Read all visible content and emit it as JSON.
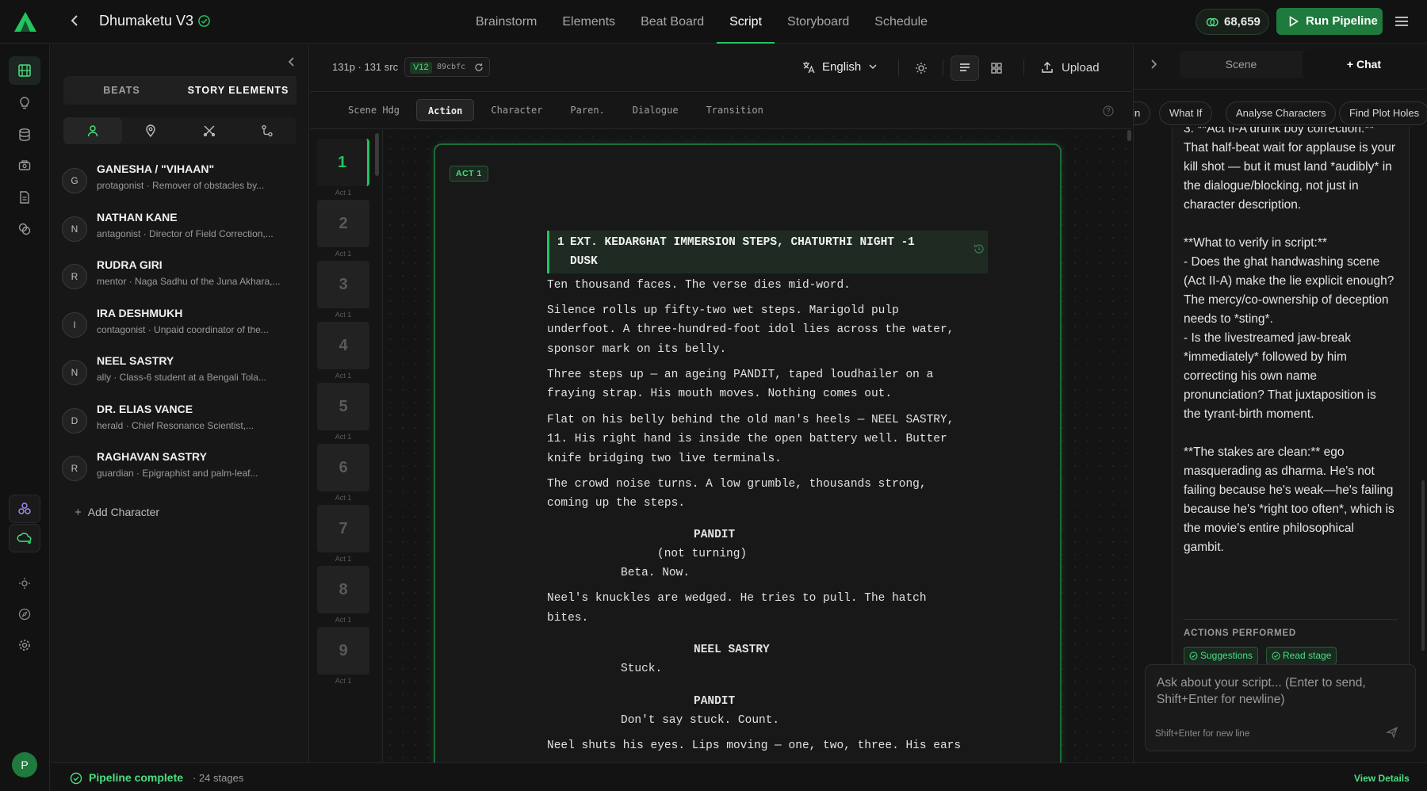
{
  "header": {
    "project_title": "Dhumaketu V3",
    "nav_tabs": [
      "Brainstorm",
      "Elements",
      "Beat Board",
      "Script",
      "Storyboard",
      "Schedule"
    ],
    "active_tab": "Script",
    "credits": "68,659",
    "run_label": "Run Pipeline",
    "accent_color": "#22c55e"
  },
  "left_panel": {
    "tabs": [
      "BEATS",
      "STORY ELEMENTS"
    ],
    "active_tab": "STORY ELEMENTS",
    "filters": [
      "person-icon",
      "location-pin-icon",
      "prop-icon",
      "flow-icon"
    ],
    "characters": [
      {
        "initial": "G",
        "name": "GANESHA / \"VIHAAN\"",
        "desc": "protagonist · Remover of obstacles by..."
      },
      {
        "initial": "N",
        "name": "NATHAN KANE",
        "desc": "antagonist · Director of Field Correction,..."
      },
      {
        "initial": "R",
        "name": "RUDRA GIRI",
        "desc": "mentor · Naga Sadhu of the Juna Akhara,..."
      },
      {
        "initial": "I",
        "name": "IRA DESHMUKH",
        "desc": "contagonist · Unpaid coordinator of the..."
      },
      {
        "initial": "N",
        "name": "NEEL SASTRY",
        "desc": "ally · Class-6 student at a Bengali Tola..."
      },
      {
        "initial": "D",
        "name": "DR. ELIAS VANCE",
        "desc": "herald · Chief Resonance Scientist,..."
      },
      {
        "initial": "R",
        "name": "RAGHAVAN SASTRY",
        "desc": "guardian · Epigraphist and palm-leaf..."
      }
    ],
    "add_label": "Add Character"
  },
  "toolbar": {
    "page_count": "131p · 131 src",
    "version": "V12",
    "hash": "89cbfc",
    "language": "English",
    "upload_label": "Upload",
    "elements": [
      "Scene Hdg",
      "Action",
      "Character",
      "Paren.",
      "Dialogue",
      "Transition"
    ],
    "active_element": "Action"
  },
  "scenes": [
    {
      "num": "1",
      "act": "Act 1"
    },
    {
      "num": "2",
      "act": "Act 1"
    },
    {
      "num": "3",
      "act": "Act 1"
    },
    {
      "num": "4",
      "act": "Act 1"
    },
    {
      "num": "5",
      "act": "Act 1"
    },
    {
      "num": "6",
      "act": "Act 1"
    },
    {
      "num": "7",
      "act": "Act 1"
    },
    {
      "num": "8",
      "act": "Act 1"
    },
    {
      "num": "9",
      "act": "Act 1"
    }
  ],
  "script": {
    "act_badge": "ACT 1",
    "heading_num": "1",
    "heading_line1": "EXT. KEDARGHAT IMMERSION STEPS, CHATURTHI NIGHT -",
    "heading_line2": "DUSK",
    "heading_num_right": "1",
    "lines": [
      "Ten thousand faces. The verse dies mid-word.",
      "Silence rolls up fifty-two wet steps. Marigold pulp",
      "underfoot. A three-hundred-foot idol lies across the water,",
      "sponsor mark on its belly.",
      "Three steps up — an ageing PANDIT, taped loudhailer on a",
      "fraying strap. His mouth moves. Nothing comes out.",
      "Flat on his belly behind the old man's heels — NEEL SASTRY,",
      "11. His right hand is inside the open battery well. Butter",
      "knife bridging two live terminals.",
      "The crowd noise turns. A low grumble, thousands strong,",
      "coming up the steps.",
      "PANDIT",
      "(not turning)",
      "Beta. Now.",
      "Neel's knuckles are wedged. He tries to pull. The hatch",
      "bites.",
      "NEEL SASTRY",
      "Stuck.",
      "PANDIT",
      "Don't say stuck. Count.",
      "Neel shuts his eyes. Lips moving — one, two, three. His ears"
    ]
  },
  "right_panel": {
    "tabs": [
      "Scene",
      "+ Chat"
    ],
    "active_tab": "+ Chat",
    "chips": [
      "ain",
      "What If",
      "Analyse Characters",
      "Find Plot Holes"
    ],
    "message": "3. **Act II-A drunk boy correction:**\nThat half-beat wait for applause is your kill shot — but it must land *audibly* in the dialogue/blocking, not just in character description.\n\n**What to verify in script:**\n- Does the ghat handwashing scene (Act II-A) make the lie explicit enough? The mercy/co-ownership of deception needs to *sting*.\n- Is the livestreamed jaw-break *immediately* followed by him correcting his own name pronunciation? That juxtaposition is the tyrant-birth moment.\n\n**The stakes are clean:** ego masquerading as dharma. He's not failing because he's weak—he's failing because he's *right too often*, which is the movie's entire philosophical gambit.",
    "actions_label": "ACTIONS PERFORMED",
    "actions": [
      "Suggestions",
      "Read stage"
    ],
    "input_placeholder": "Ask about your script... (Enter to send, Shift+Enter for newline)",
    "input_hint": "Shift+Enter for new line"
  },
  "status": {
    "complete_label": "Pipeline complete",
    "stages": "· 24 stages",
    "details_label": "View Details"
  },
  "user": {
    "initial": "P"
  }
}
